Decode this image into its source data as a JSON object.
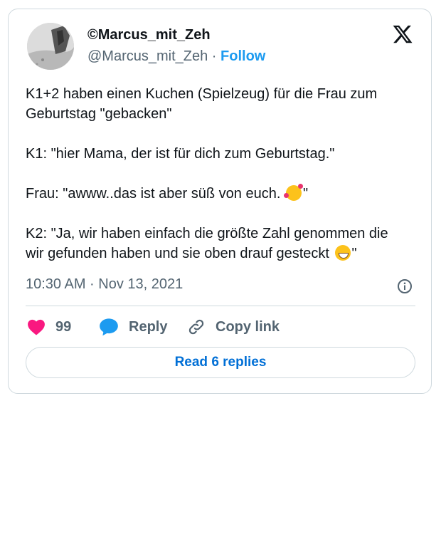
{
  "author": {
    "display_name": "©Marcus_mit_Zeh",
    "handle": "@Marcus_mit_Zeh",
    "separator": " · ",
    "follow_label": "Follow"
  },
  "tweet": {
    "lines": [
      "K1+2 haben einen Kuchen (Spielzeug) für die Frau zum",
      "Geburtstag \"gebacken\"",
      "K1: \"hier Mama, der ist für dich zum Geburtstag.\"",
      "Frau: \"awww..das ist aber süß von euch. ",
      "\"",
      "K2: \"Ja, wir haben einfach die größte Zahl genommen die",
      "wir gefunden haben und sie oben drauf gesteckt ",
      "\""
    ],
    "emojis": [
      "smiling-face-with-hearts",
      "grinning-face-with-smiling-eyes"
    ]
  },
  "timestamp": "10:30 AM · Nov 13, 2021",
  "actions": {
    "like_count": "99",
    "reply_label": "Reply",
    "copy_link_label": "Copy link"
  },
  "read_replies_label": "Read 6 replies",
  "colors": {
    "accent": "#1d9bf0",
    "like": "#f91880",
    "link": "#006fd6",
    "secondary_text": "#536471",
    "border": "#cfd9de"
  },
  "icons": [
    "x-logo-icon",
    "info-icon",
    "heart-icon",
    "reply-bubble-icon",
    "link-icon"
  ]
}
